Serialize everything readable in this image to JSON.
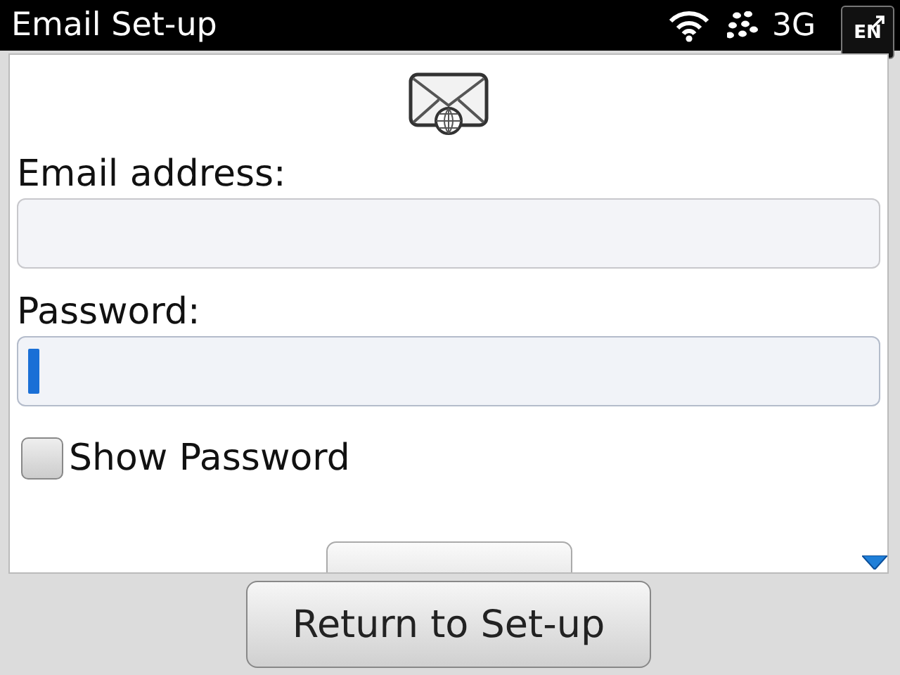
{
  "status_bar": {
    "title": "Email Set-up",
    "network": "3G",
    "input_language": "EN"
  },
  "fields": [
    {
      "label": "Email address:",
      "focused": false
    },
    {
      "label": "Password:",
      "focused": true
    }
  ],
  "show_password": {
    "label": "Show Password",
    "checked": false
  },
  "bottom_button": "Return to Set-up"
}
